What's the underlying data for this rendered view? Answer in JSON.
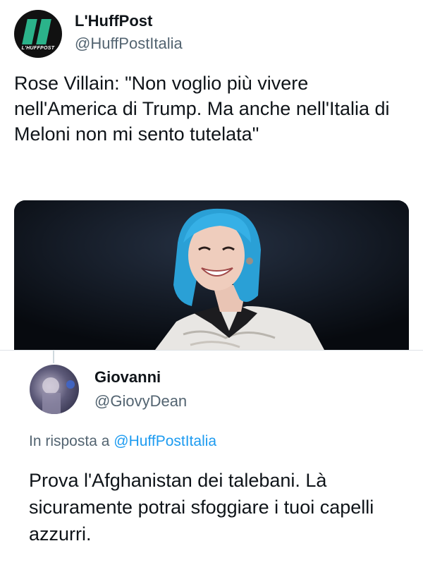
{
  "tweet": {
    "avatar_text": "L'HUFFPOST",
    "display_name": "L'HuffPost",
    "handle": "@HuffPostItalia",
    "text": "Rose Villain: \"Non voglio più vivere nell'America di Trump. Ma anche nell'Italia di Meloni non mi sento tutelata\"",
    "brand_color": "#2bb38a"
  },
  "reply": {
    "display_name": "Giovanni",
    "handle": "@GiovyDean",
    "replying_to_prefix": "In risposta a",
    "replying_to_handle": "@HuffPostItalia",
    "text": "Prova l'Afghanistan dei talebani. Là sicuramente potrai sfoggiare i tuoi capelli azzurri.",
    "link_color": "#1d9bf0"
  }
}
